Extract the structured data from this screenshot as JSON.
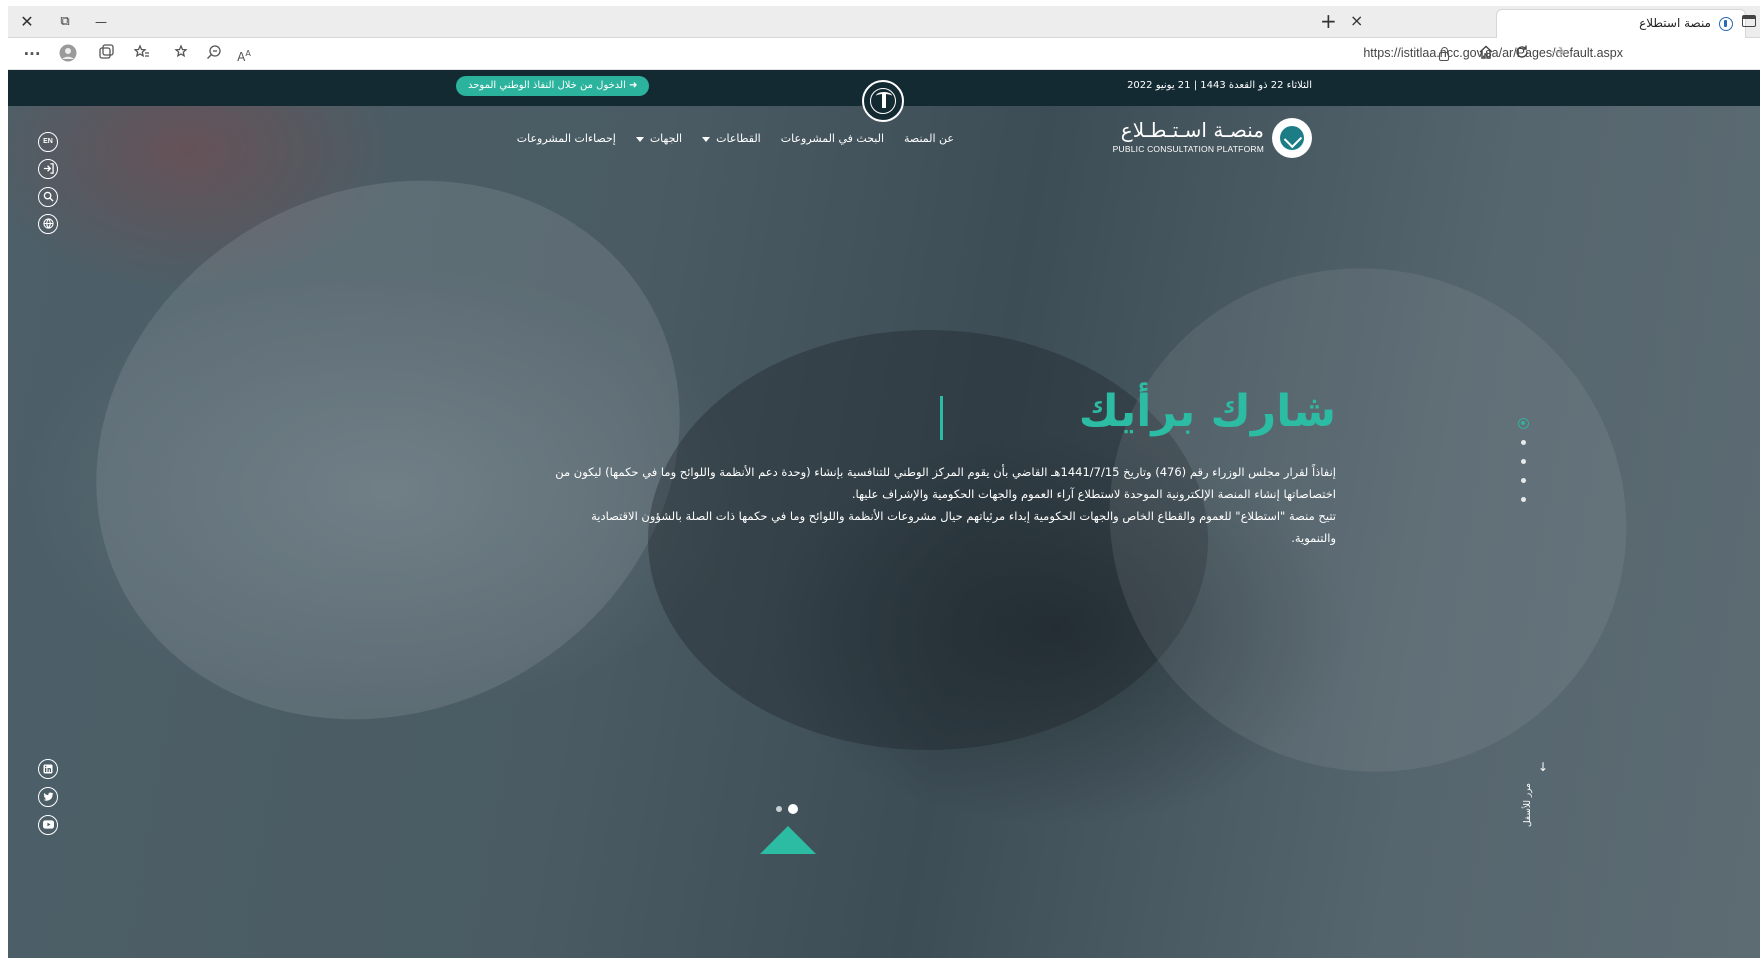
{
  "browser": {
    "tab_title": "منصة استطلاع",
    "url": "https://istitlaa.ncc.gov.sa/ar/Pages/default.aspx",
    "more_label": "···",
    "new_tab_label": "+",
    "close_tab_label": "×",
    "close_window_label": "✕",
    "restore_label": "⧉",
    "minimize_label": "—"
  },
  "topbar": {
    "date": "الثلاثاء 22 ذو القعدة 1443 | 21 يونيو 2022",
    "login_label": "الدخول من خلال النفاذ الوطني الموحد"
  },
  "logo": {
    "ar": "منصـة اسـتـطـلاع",
    "en": "PUBLIC CONSULTATION PLATFORM"
  },
  "nav": {
    "items": [
      {
        "label": "عن المنصة",
        "dropdown": false
      },
      {
        "label": "البحث في المشروعات",
        "dropdown": false
      },
      {
        "label": "القطاعات",
        "dropdown": true
      },
      {
        "label": "الجهات",
        "dropdown": true
      },
      {
        "label": "إحصاءات المشروعات",
        "dropdown": false
      }
    ]
  },
  "side_icons": {
    "lang_label": "EN"
  },
  "hero": {
    "headline": "شارك برأيك",
    "para1_line1": "إنفاذاً لقرار مجلس الوزراء رقم (476) وتاريخ 1441/7/15هـ القاضي بأن يقوم المركز الوطني للتنافسية بإنشاء (وحدة دعم الأنظمة واللوائح وما في حكمها) ليكون من",
    "para1_line2": "اختصاصاتها إنشاء المنصة الإلكترونية الموحدة لاستطلاع آراء العموم والجهات الحكومية والإشراف عليها.",
    "para2_line1": "تتيح منصة \"استطلاع\" للعموم والقطاع الخاص والجهات الحكومية إبداء مرئياتهم حيال مشروعات الأنظمة واللوائح وما في حكمها ذات الصلة بالشؤون الاقتصادية",
    "para2_line2": "والتنموية."
  },
  "scroll_hint": "مرر للأسفل",
  "slider": {
    "count": 2,
    "active": 2
  },
  "section_dots": {
    "count": 5,
    "active": 1
  },
  "colors": {
    "accent": "#2cbba3",
    "topbar": "#142a33"
  },
  "icons": [
    "search-icon",
    "globe-icon",
    "login-icon",
    "linkedin-icon",
    "twitter-icon",
    "youtube-icon",
    "home-icon",
    "refresh-icon",
    "lock-icon"
  ]
}
